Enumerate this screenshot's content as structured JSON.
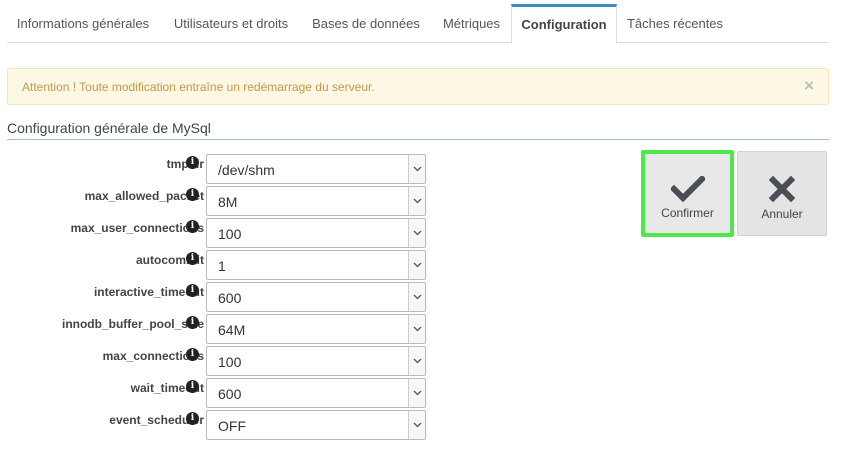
{
  "tabs": [
    {
      "label": "Informations générales"
    },
    {
      "label": "Utilisateurs et droits"
    },
    {
      "label": "Bases de données"
    },
    {
      "label": "Métriques"
    },
    {
      "label": "Configuration"
    },
    {
      "label": "Tâches récentes"
    }
  ],
  "active_tab": "Configuration",
  "alert": {
    "message": "Attention ! Toute modification entraîne un redémarrage du serveur.",
    "close": "×"
  },
  "section": {
    "title": "Configuration générale de MySql"
  },
  "fields": [
    {
      "label": "tmpdir",
      "value": "/dev/shm"
    },
    {
      "label": "max_allowed_packet",
      "value": "8M"
    },
    {
      "label": "max_user_connections",
      "value": "100"
    },
    {
      "label": "autocommit",
      "value": "1"
    },
    {
      "label": "interactive_timeout",
      "value": "600"
    },
    {
      "label": "innodb_buffer_pool_size",
      "value": "64M"
    },
    {
      "label": "max_connections",
      "value": "100"
    },
    {
      "label": "wait_timeout",
      "value": "600"
    },
    {
      "label": "event_scheduler",
      "value": "OFF"
    }
  ],
  "buttons": {
    "confirm": {
      "label": "Confirmer",
      "icon": "check-icon"
    },
    "cancel": {
      "label": "Annuler",
      "icon": "cross-icon"
    }
  },
  "colors": {
    "tab_accent": "#3c8dbc",
    "alert_bg": "#fcf8e3",
    "alert_text": "#c19a4a",
    "confirm_highlight": "#4fe84a"
  }
}
